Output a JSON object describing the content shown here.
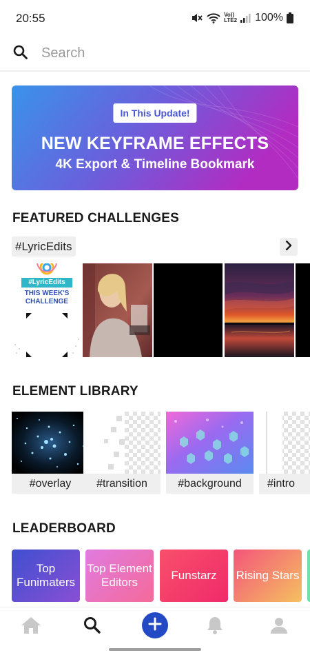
{
  "status_bar": {
    "time": "20:55",
    "network": "Vo))\nLTE2",
    "battery": "100%"
  },
  "search": {
    "placeholder": "Search"
  },
  "banner": {
    "tag": "In This Update!",
    "headline": "NEW KEYFRAME EFFECTS",
    "subline": "4K Export & Timeline Bookmark",
    "gradient": [
      "#3a8ee8",
      "#7a4ed6",
      "#b02fc4"
    ]
  },
  "featured": {
    "title": "FEATURED CHALLENGES",
    "chip": "#LyricEdits",
    "thumb1": {
      "badge": "#LyricEdits",
      "line1": "THIS WEEK'S",
      "line2": "CHALLENGE"
    }
  },
  "library": {
    "title": "ELEMENT LIBRARY",
    "items": [
      {
        "label": "#overlay"
      },
      {
        "label": "#transition"
      },
      {
        "label": "#background"
      },
      {
        "label": "#intro"
      }
    ]
  },
  "leaderboard": {
    "title": "LEADERBOARD",
    "cards": [
      {
        "label": "Top Funimaters",
        "from": "#3f4fd0",
        "to": "#8a4fd4"
      },
      {
        "label": "Top Element Editors",
        "from": "#e07be0",
        "to": "#f56a9a"
      },
      {
        "label": "Funstarz",
        "from": "#f8506a",
        "to": "#f02a6a"
      },
      {
        "label": "Rising Stars",
        "from": "#f4557a",
        "to": "#f5c060"
      }
    ]
  },
  "colors": {
    "accent": "#2349c4",
    "nav_inactive": "#c8c8c8"
  }
}
